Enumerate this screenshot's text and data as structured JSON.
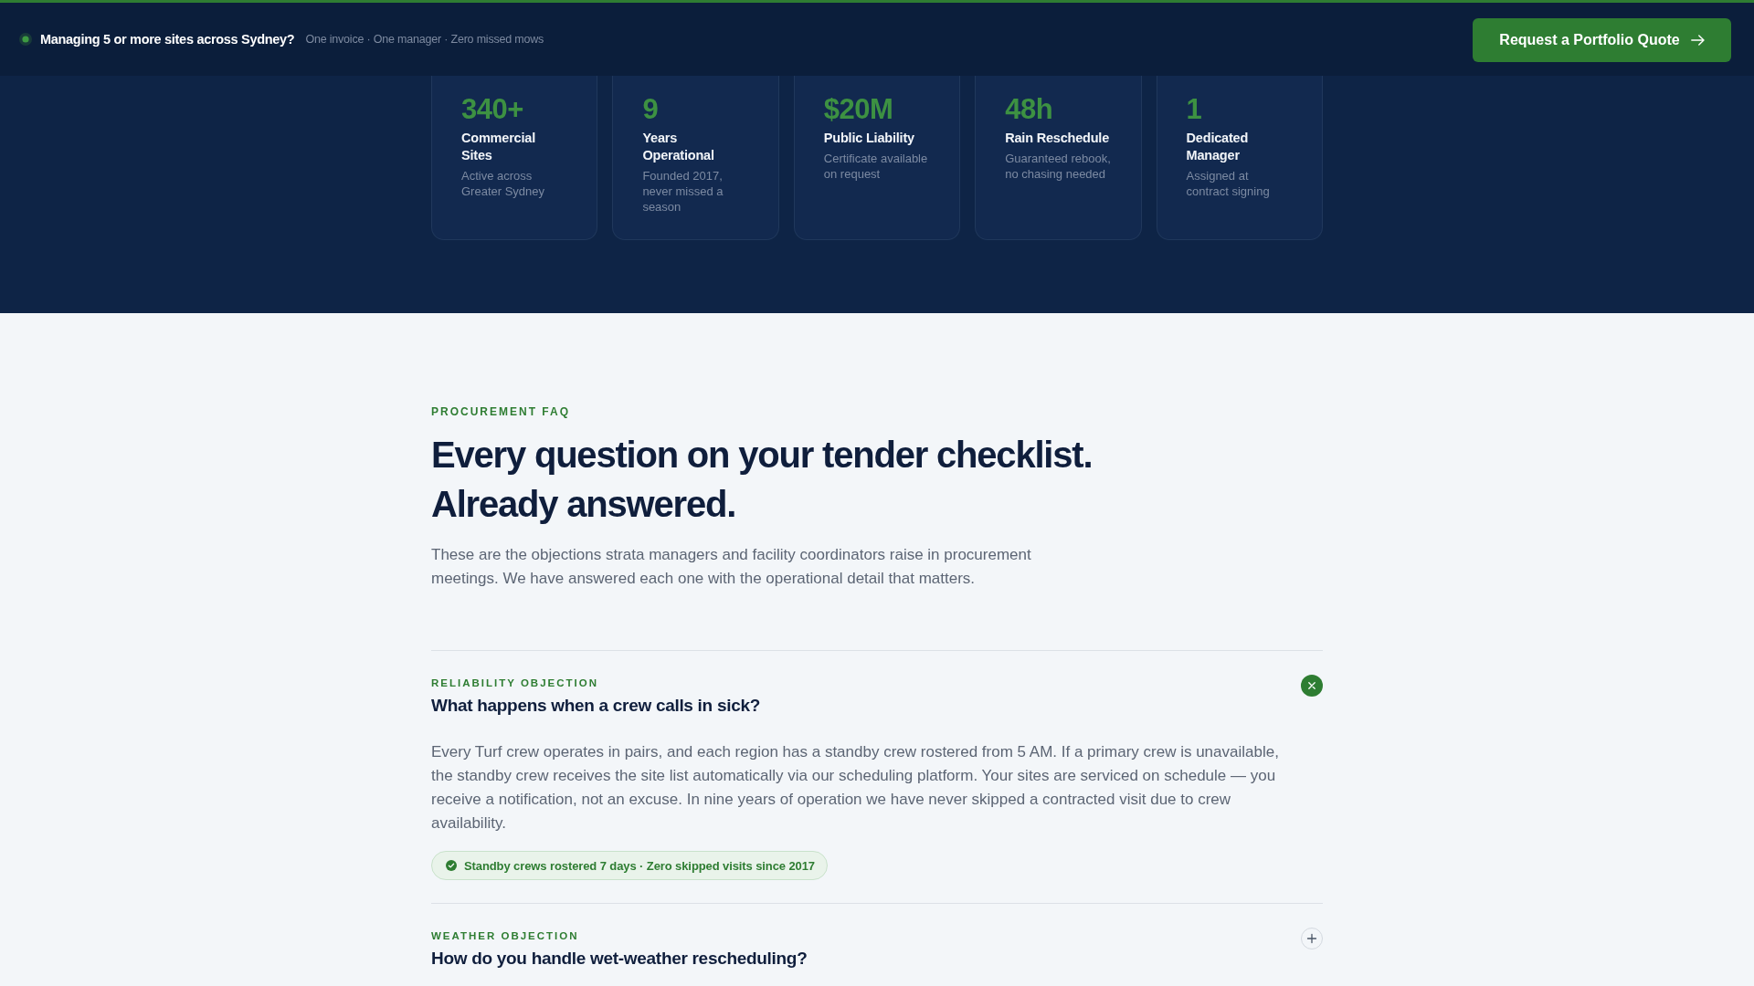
{
  "announcement_bar": {
    "headline": "Managing 5 or more sites across Sydney?",
    "subline": "One invoice · One manager · Zero missed mows",
    "cta_button": "Request a Portfolio Quote"
  },
  "stats": [
    {
      "value": "340+",
      "label": "Commercial Sites",
      "detail": "Active across Greater Sydney"
    },
    {
      "value": "9",
      "label": "Years Operational",
      "detail": "Founded 2017, never missed a season"
    },
    {
      "value": "$20M",
      "label": "Public Liability",
      "detail": "Certificate available on request"
    },
    {
      "value": "48h",
      "label": "Rain Reschedule",
      "detail": "Guaranteed rebook, no chasing needed"
    },
    {
      "value": "1",
      "label": "Dedicated Manager",
      "detail": "Assigned at contract signing"
    }
  ],
  "faq": {
    "eyebrow": "PROCUREMENT FAQ",
    "heading": "Every question on your tender checklist. Already answered.",
    "intro": "These are the objections strata managers and facility coordinators raise in procurement meetings. We have answered each one with the operational detail that matters.",
    "items": [
      {
        "category": "RELIABILITY OBJECTION",
        "question": "What happens when a crew calls in sick?",
        "expanded": true,
        "answer": "Every Turf crew operates in pairs, and each region has a standby crew rostered from 5 AM. If a primary crew is unavailable, the standby crew receives the site list automatically via our scheduling platform. Your sites are serviced on schedule — you receive a notification, not an excuse. In nine years of operation we have never skipped a contracted visit due to crew availability.",
        "proof": "Standby crews rostered 7 days · Zero skipped visits since 2017"
      },
      {
        "category": "WEATHER OBJECTION",
        "question": "How do you handle wet-weather rescheduling?",
        "expanded": false
      }
    ]
  }
}
